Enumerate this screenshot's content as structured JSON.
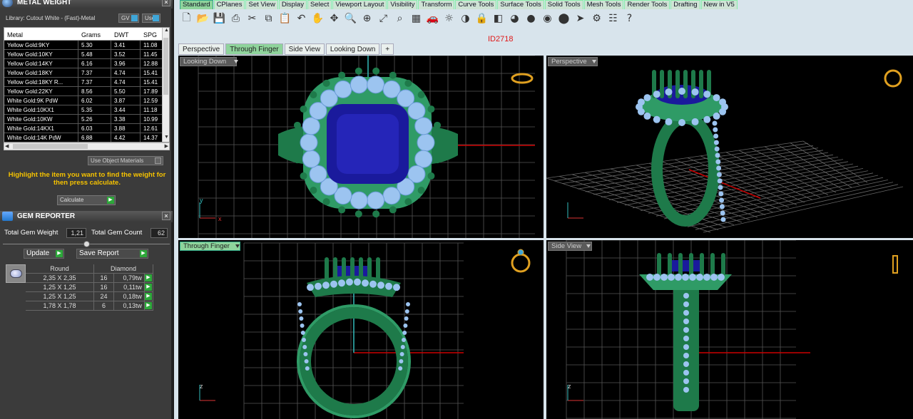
{
  "metal_panel": {
    "title": "METAL WEIGHT",
    "library": "Library: Cutout White - (Fast)-Metal",
    "gv_label": "GV",
    "user_label": "User",
    "headers": [
      "Metal",
      "Grams",
      "DWT",
      "SPG"
    ],
    "rows": [
      [
        "Yellow Gold:9KY",
        "5.30",
        "3.41",
        "11.08"
      ],
      [
        "Yellow Gold:10KY",
        "5.48",
        "3.52",
        "11.45"
      ],
      [
        "Yellow Gold:14KY",
        "6.16",
        "3.96",
        "12.88"
      ],
      [
        "Yellow Gold:18KY",
        "7.37",
        "4.74",
        "15.41"
      ],
      [
        "Yellow Gold:18KY R...",
        "7.37",
        "4.74",
        "15.41"
      ],
      [
        "Yellow Gold:22KY",
        "8.56",
        "5.50",
        "17.89"
      ],
      [
        "White Gold:9K PdW",
        "6.02",
        "3.87",
        "12.59"
      ],
      [
        "White Gold:10KX1",
        "5.35",
        "3.44",
        "11.18"
      ],
      [
        "White Gold:10KW",
        "5.26",
        "3.38",
        "10.99"
      ],
      [
        "White Gold:14KX1",
        "6.03",
        "3.88",
        "12.61"
      ],
      [
        "White Gold:14K PdW",
        "6.88",
        "4.42",
        "14.37"
      ]
    ],
    "use_object_materials": "Use Object Materials",
    "hint": "Highlight the item you want to find the weight for then press calculate.",
    "calculate_label": "Calculate"
  },
  "gem_panel": {
    "title": "GEM REPORTER",
    "total_weight_label": "Total Gem Weight",
    "total_weight_value": "1,21",
    "total_count_label": "Total Gem Count",
    "total_count_value": "62",
    "update_label": "Update",
    "save_label": "Save Report",
    "headers": [
      "Round",
      "Diamond"
    ],
    "rows": [
      [
        "2,35 X 2,35",
        "16",
        "0,79tw"
      ],
      [
        "1,25 X 1,25",
        "16",
        "0,11tw"
      ],
      [
        "1,25 X 1,25",
        "24",
        "0,18tw"
      ],
      [
        "1,78 X 1,78",
        "6",
        "0,13tw"
      ]
    ]
  },
  "toolbar_tabs": [
    "Standard",
    "CPlanes",
    "Set View",
    "Display",
    "Select",
    "Viewport Layout",
    "Visibility",
    "Transform",
    "Curve Tools",
    "Surface Tools",
    "Solid Tools",
    "Mesh Tools",
    "Render Tools",
    "Drafting",
    "New in V5"
  ],
  "toolbar_icons": [
    "new-icon",
    "open-icon",
    "save-icon",
    "print-icon",
    "cut-icon",
    "copy-icon",
    "paste-icon",
    "undo-icon",
    "pan-hand-icon",
    "rotate-icon",
    "zoom-icon",
    "zoom-window-icon",
    "zoom-extents-icon",
    "zoom-selected-icon",
    "grid-layout-icon",
    "car-icon",
    "light-icon",
    "visibility-icon",
    "lock-icon",
    "layer-icon",
    "color-icon",
    "render-shaded-icon",
    "render-material-icon",
    "render-sphere-icon",
    "pointer-icon",
    "settings-icon",
    "options-icon",
    "help-icon"
  ],
  "document_id": "ID2718",
  "view_tabs": [
    "Perspective",
    "Through Finger",
    "Side View",
    "Looking Down"
  ],
  "viewports": {
    "top_left": "Looking Down",
    "top_right": "Perspective",
    "bottom_left": "Through Finger",
    "bottom_right": "Side View"
  },
  "colors": {
    "metal_green": "#1e7a4a",
    "gem_blue": "#1a1a9c",
    "diamond": "#9cc4f0",
    "accent_tab": "#8fd49c",
    "hint_text": "#f5c200"
  }
}
